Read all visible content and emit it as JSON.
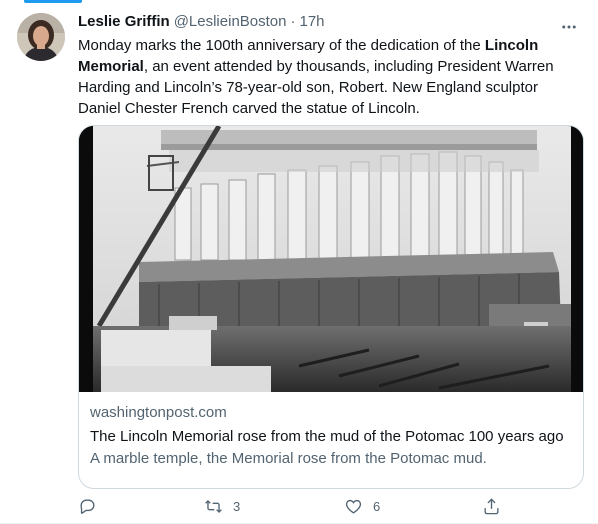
{
  "tweet": {
    "author_name": "Leslie Griffin",
    "author_handle": "@LeslieinBoston",
    "separator": "·",
    "time": "17h",
    "text_parts": [
      "Monday marks the 100th anniversary of the dedication of the ",
      "Lincoln Memorial",
      ", an event attended by thousands, including President Warren Harding and Lincoln’s 78-year-old son, Robert. New England sculptor Daniel Chester French carved the statue of Lincoln."
    ]
  },
  "card": {
    "domain": "washingtonpost.com",
    "title": "The Lincoln Memorial rose from the mud of the Potomac 100 years ago",
    "description": "A marble temple, the Memorial rose from the Potomac mud."
  },
  "actions": {
    "reply_icon": "reply-icon",
    "retweet_icon": "retweet-icon",
    "retweet_count": "3",
    "like_icon": "heart-icon",
    "like_count": "6",
    "share_icon": "share-icon"
  },
  "colors": {
    "accent": "#1d9bf0",
    "text": "#0f1419",
    "secondary": "#536471",
    "border": "#cfd9de"
  }
}
